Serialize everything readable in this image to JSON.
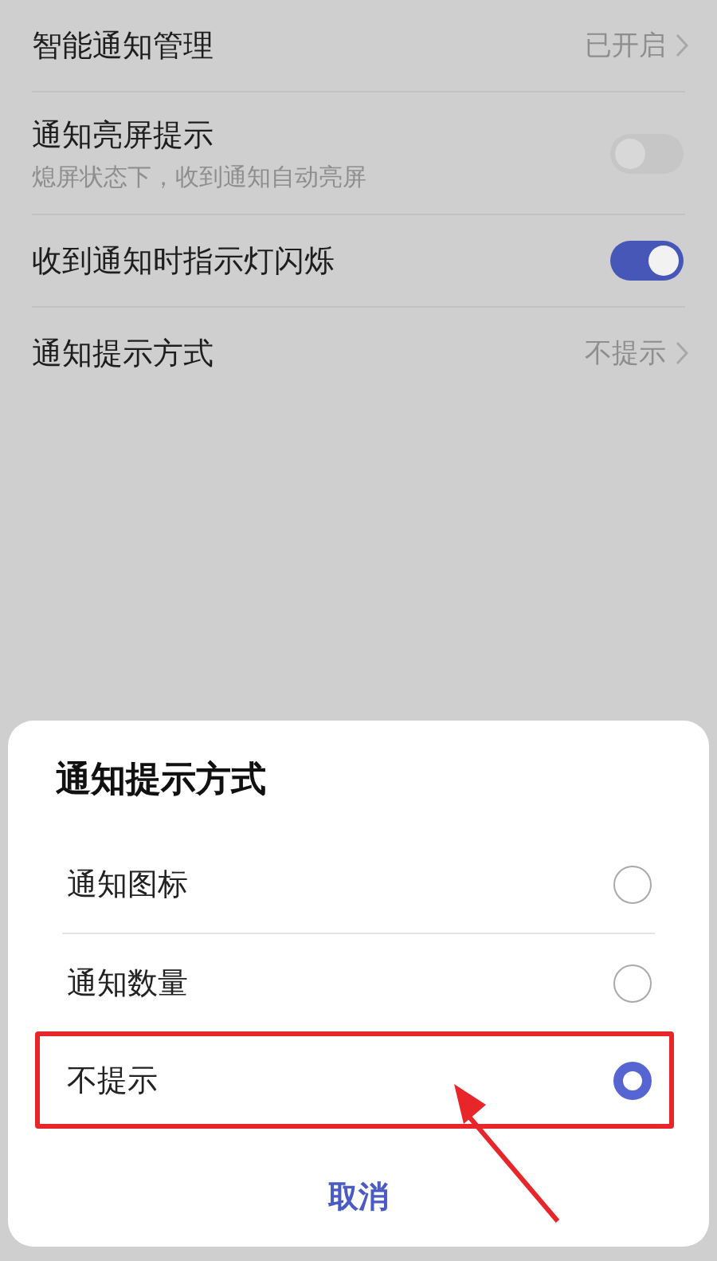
{
  "settings": [
    {
      "kind": "link",
      "title": "智能通知管理",
      "value": "已开启"
    },
    {
      "kind": "toggle",
      "title": "通知亮屏提示",
      "subtitle": "熄屏状态下，收到通知自动亮屏",
      "on": false
    },
    {
      "kind": "toggle",
      "title": "收到通知时指示灯闪烁",
      "on": true
    },
    {
      "kind": "link",
      "title": "通知提示方式",
      "value": "不提示"
    }
  ],
  "dialog": {
    "title": "通知提示方式",
    "options": [
      {
        "label": "通知图标",
        "selected": false,
        "highlighted": false
      },
      {
        "label": "通知数量",
        "selected": false,
        "highlighted": false
      },
      {
        "label": "不提示",
        "selected": true,
        "highlighted": true
      }
    ],
    "cancel": "取消",
    "annotation_arrow": true
  }
}
